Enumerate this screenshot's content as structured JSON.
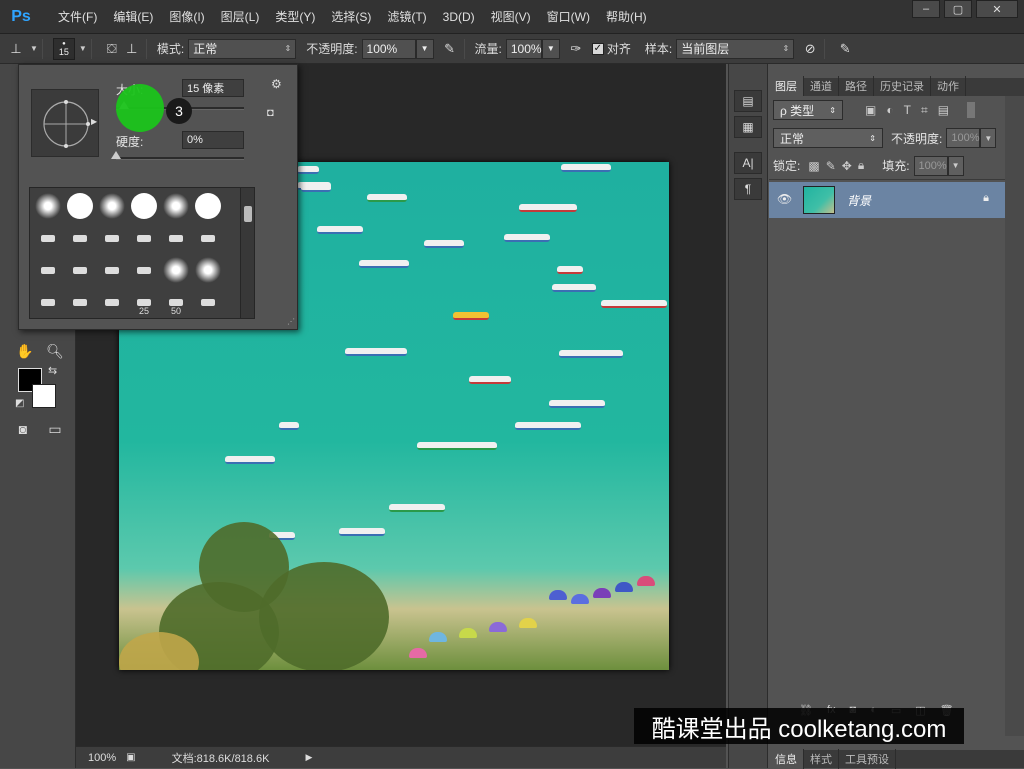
{
  "app": {
    "logo": "Ps",
    "menu": [
      "文件(F)",
      "编辑(E)",
      "图像(I)",
      "图层(L)",
      "类型(Y)",
      "选择(S)",
      "滤镜(T)",
      "3D(D)",
      "视图(V)",
      "窗口(W)",
      "帮助(H)"
    ],
    "window_controls": {
      "minimize": "–",
      "restore": "▢",
      "close": "✕"
    }
  },
  "options_bar": {
    "brush_size": "15",
    "mode_label": "模式:",
    "mode_value": "正常",
    "opacity_label": "不透明度:",
    "opacity_value": "100%",
    "flow_label": "流量:",
    "flow_value": "100%",
    "align_label": "对齐",
    "align_checked": true,
    "sample_label": "样本:",
    "sample_value": "当前图层"
  },
  "brush_picker": {
    "size_label": "大小:",
    "size_value": "15 像素",
    "hardness_label": "硬度:",
    "hardness_value": "0%",
    "size_fraction": 0.06,
    "hardness_fraction": 0.0,
    "preset_numbers": [
      "25",
      "50"
    ]
  },
  "tutorial": {
    "step_number": "3",
    "watermark": "酷课堂出品 coolketang.com"
  },
  "status_bar": {
    "zoom": "100%",
    "doc_info": "文档:818.6K/818.6K"
  },
  "layers_panel": {
    "tabs": [
      "图层",
      "通道",
      "路径",
      "历史记录",
      "动作"
    ],
    "active_tab": "图层",
    "filter_label": "ρ 类型",
    "blend_mode": "正常",
    "opacity_label": "不透明度:",
    "opacity_value": "100%",
    "lock_label": "锁定:",
    "fill_label": "填充:",
    "fill_value": "100%",
    "layer_name": "背景",
    "bottom_tabs": [
      "信息",
      "样式",
      "工具预设"
    ]
  },
  "colors": {
    "accent": "#2fa4ff",
    "selected_layer": "#6b84a3",
    "cursor_highlight": "#1bc41b"
  }
}
